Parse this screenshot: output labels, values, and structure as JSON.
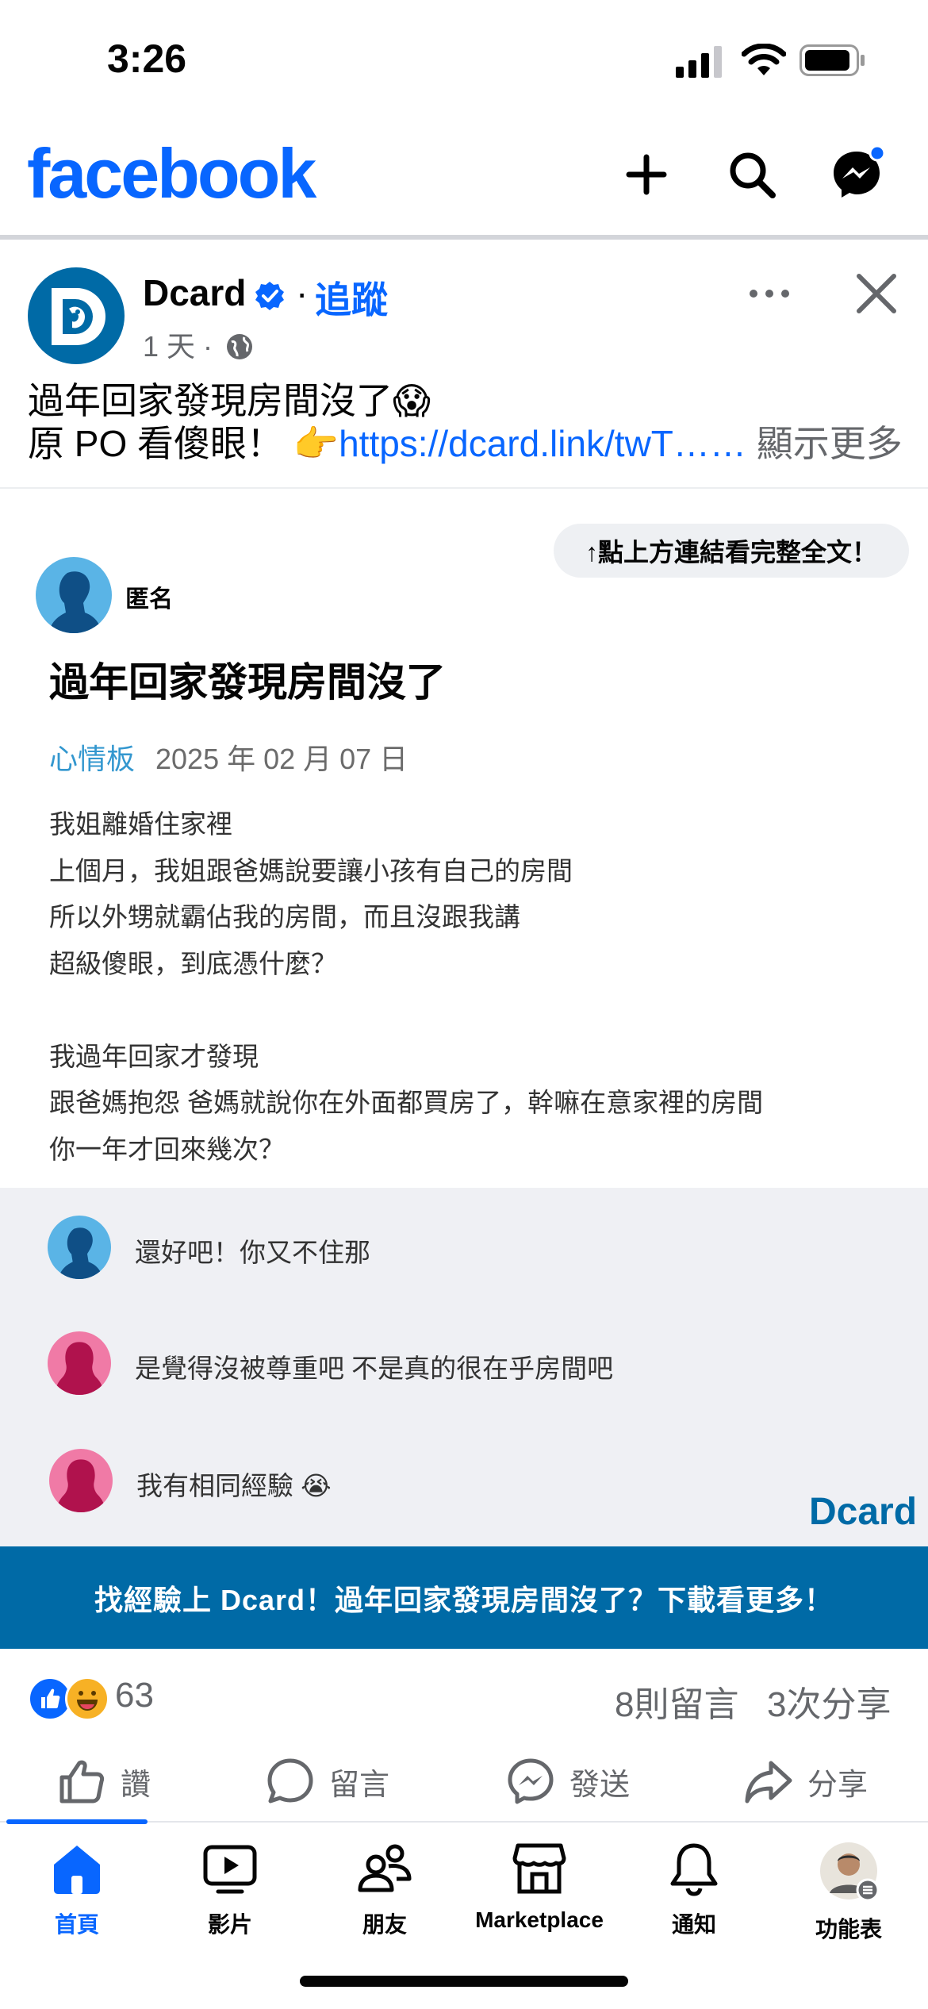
{
  "status_bar": {
    "time": "3:26"
  },
  "header": {
    "logo": "facebook",
    "icons": [
      "plus-icon",
      "search-icon",
      "messenger-icon"
    ]
  },
  "post": {
    "page_name": "Dcard",
    "separator": "·",
    "follow_label": "追蹤",
    "time": "1 天 ·",
    "text_line1": "過年回家發現房間沒了😱",
    "text_line2_prefix": "原 PO 看傻眼！ 👉",
    "link_text": "https://dcard.link/twT……",
    "see_more": "顯示更多"
  },
  "preview": {
    "hint": "↑點上方連結看完整全文！",
    "author": "匿名",
    "title": "過年回家發現房間沒了",
    "board": "心情板",
    "date": "2025 年 02 月 07 日",
    "body_lines": [
      "我姐離婚住家裡",
      "上個月，我姐跟爸媽說要讓小孩有自己的房間",
      "所以外甥就霸佔我的房間，而且沒跟我講",
      "超級傻眼，到底憑什麼？",
      "",
      "我過年回家才發現",
      "跟爸媽抱怨 爸媽就說你在外面都買房了，幹嘛在意家裡的房間",
      "你一年才回來幾次？"
    ],
    "comments": [
      {
        "text": "還好吧！你又不住那"
      },
      {
        "text": "是覺得沒被尊重吧 不是真的很在乎房間吧"
      },
      {
        "text": "我有相同經驗 😭"
      }
    ],
    "brand": "Dcard",
    "cta": "找經驗上 Dcard！過年回家發現房間沒了？下載看更多！"
  },
  "stats": {
    "reactions": "63",
    "comments": "8則留言",
    "shares": "3次分享"
  },
  "actions": {
    "like": "讚",
    "comment": "留言",
    "send": "發送",
    "share": "分享"
  },
  "bottom_nav": {
    "home": "首頁",
    "video": "影片",
    "friends": "朋友",
    "marketplace": "Marketplace",
    "notifications": "通知",
    "menu": "功能表"
  },
  "colors": {
    "facebook_blue": "#0866ff",
    "dcard_blue": "#006aa6",
    "board_blue": "#3397cf"
  }
}
